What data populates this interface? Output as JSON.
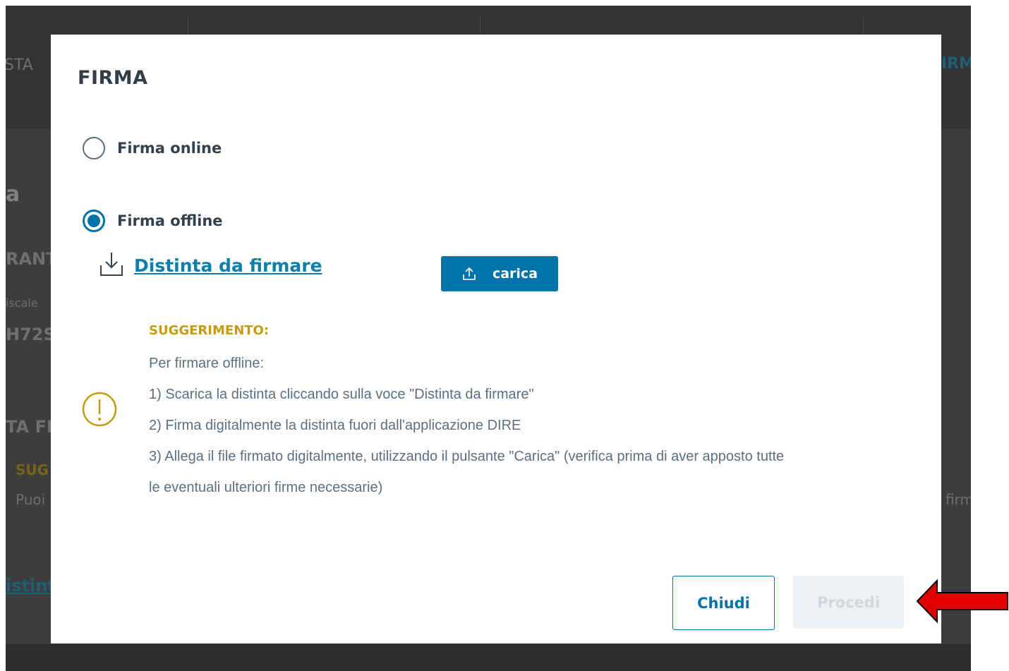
{
  "background": {
    "fragments": {
      "tab_left": "STA",
      "tab_right": "IRM",
      "heading": "a",
      "section_label": "RANT",
      "field_label": "iscale",
      "field_value": "H72S",
      "section2": "TA FIF",
      "tip_label": "SUG",
      "tip_text": "Puoi",
      "tip_text_right": "firm",
      "link": "istint"
    }
  },
  "modal": {
    "title": "FIRMA",
    "options": [
      {
        "label": "Firma online",
        "checked": false
      },
      {
        "label": "Firma offline",
        "checked": true
      }
    ],
    "download_link": "Distinta da firmare",
    "upload_button": "carica",
    "tip": {
      "title": "SUGGERIMENTO:",
      "lines": [
        "Per firmare offline:",
        "1) Scarica la distinta cliccando sulla voce \"Distinta da firmare\"",
        "2) Firma digitalmente la distinta fuori dall'applicazione DIRE",
        "3) Allega il file firmato digitalmente, utilizzando il pulsante \"Carica\" (verifica prima di aver apposto tutte",
        "le eventuali ulteriori firme necessarie)"
      ]
    },
    "buttons": {
      "close": "Chiudi",
      "proceed": "Procedi",
      "proceed_disabled": true
    }
  },
  "colors": {
    "primary": "#0073a8",
    "link": "#0d7fa8",
    "warning": "#c89a10",
    "annotation_arrow": "#e00000"
  }
}
